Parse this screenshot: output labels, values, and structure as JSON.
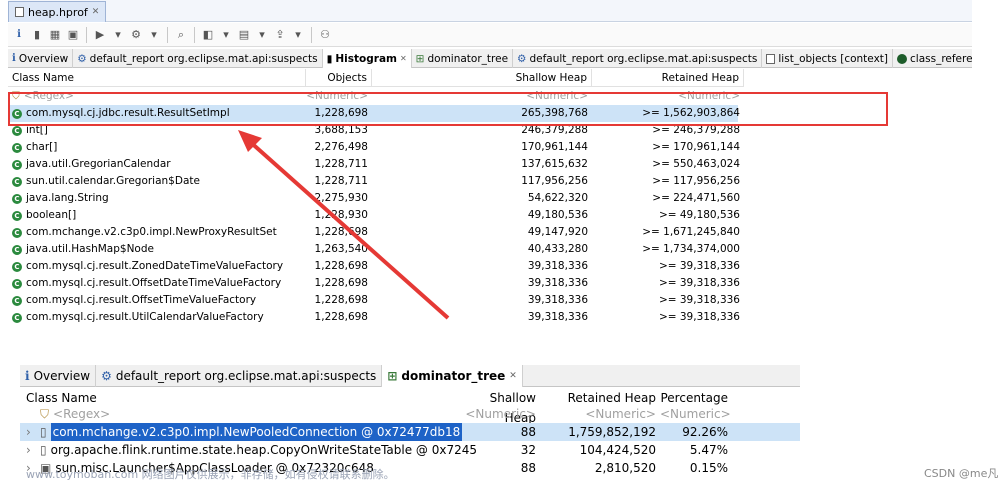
{
  "editor_tab": {
    "title": "heap.hprof",
    "close": "✕"
  },
  "tabs_top": [
    {
      "label": "Overview",
      "icon": "info-icon"
    },
    {
      "label": "default_report  org.eclipse.mat.api:suspects",
      "icon": "report-icon"
    },
    {
      "label": "Histogram",
      "icon": "histogram-icon",
      "close": "✕"
    },
    {
      "label": "dominator_tree",
      "icon": "tree-icon"
    },
    {
      "label": "default_report  org.eclipse.mat.api:suspects",
      "icon": "report-icon"
    },
    {
      "label": "list_objects [context]",
      "icon": "list-icon"
    },
    {
      "label": "class_references [contex",
      "icon": "class-icon"
    }
  ],
  "histogram": {
    "headers": {
      "name": "Class Name",
      "objects": "Objects",
      "shallow": "Shallow Heap",
      "retained": "Retained Heap"
    },
    "filter": {
      "name": "<Regex>",
      "objects": "<Numeric>",
      "shallow": "<Numeric>",
      "retained": "<Numeric>"
    },
    "rows": [
      {
        "name": "com.mysql.cj.jdbc.result.ResultSetImpl",
        "objects": "1,228,698",
        "shallow": "265,398,768",
        "retained": ">= 1,562,903,864"
      },
      {
        "name": "int[]",
        "objects": "3,688,153",
        "shallow": "246,379,288",
        "retained": ">= 246,379,288"
      },
      {
        "name": "char[]",
        "objects": "2,276,498",
        "shallow": "170,961,144",
        "retained": ">= 170,961,144"
      },
      {
        "name": "java.util.GregorianCalendar",
        "objects": "1,228,711",
        "shallow": "137,615,632",
        "retained": ">= 550,463,024"
      },
      {
        "name": "sun.util.calendar.Gregorian$Date",
        "objects": "1,228,711",
        "shallow": "117,956,256",
        "retained": ">= 117,956,256"
      },
      {
        "name": "java.lang.String",
        "objects": "2,275,930",
        "shallow": "54,622,320",
        "retained": ">= 224,471,560"
      },
      {
        "name": "boolean[]",
        "objects": "1,228,930",
        "shallow": "49,180,536",
        "retained": ">= 49,180,536"
      },
      {
        "name": "com.mchange.v2.c3p0.impl.NewProxyResultSet",
        "objects": "1,228,698",
        "shallow": "49,147,920",
        "retained": ">= 1,671,245,840"
      },
      {
        "name": "java.util.HashMap$Node",
        "objects": "1,263,540",
        "shallow": "40,433,280",
        "retained": ">= 1,734,374,000"
      },
      {
        "name": "com.mysql.cj.result.ZonedDateTimeValueFactory",
        "objects": "1,228,698",
        "shallow": "39,318,336",
        "retained": ">= 39,318,336"
      },
      {
        "name": "com.mysql.cj.result.OffsetDateTimeValueFactory",
        "objects": "1,228,698",
        "shallow": "39,318,336",
        "retained": ">= 39,318,336"
      },
      {
        "name": "com.mysql.cj.result.OffsetTimeValueFactory",
        "objects": "1,228,698",
        "shallow": "39,318,336",
        "retained": ">= 39,318,336"
      },
      {
        "name": "com.mysql.cj.result.UtilCalendarValueFactory",
        "objects": "1,228,698",
        "shallow": "39,318,336",
        "retained": ">= 39,318,336"
      }
    ]
  },
  "tabs_bottom": [
    {
      "label": "Overview",
      "icon": "info-icon"
    },
    {
      "label": "default_report  org.eclipse.mat.api:suspects",
      "icon": "report-icon"
    },
    {
      "label": "dominator_tree",
      "icon": "tree-icon",
      "close": "✕"
    }
  ],
  "dominator": {
    "headers": {
      "name": "Class Name",
      "shallow": "Shallow Heap",
      "retained": "Retained Heap",
      "pct": "Percentage"
    },
    "filter": {
      "name": "<Regex>",
      "shallow": "<Numeric>",
      "retained": "<Numeric>",
      "pct": "<Numeric>"
    },
    "rows": [
      {
        "name": "com.mchange.v2.c3p0.impl.NewPooledConnection @ 0x72477db18",
        "shallow": "88",
        "retained": "1,759,852,192",
        "pct": "92.26%"
      },
      {
        "name": "org.apache.flink.runtime.state.heap.CopyOnWriteStateTable @ 0x7245",
        "shallow": "32",
        "retained": "104,424,520",
        "pct": "5.47%"
      },
      {
        "name": "sun.misc.Launcher$AppClassLoader @ 0x72320c648",
        "shallow": "88",
        "retained": "2,810,520",
        "pct": "0.15%"
      }
    ]
  },
  "watermark": "www.toymoban.com 网络图片仅供展示，非存储，如有侵权请联系删除。",
  "credit": "CSDN @me凡",
  "colors": {
    "highlight": "#cde3f7",
    "annotation": "#e53935"
  }
}
